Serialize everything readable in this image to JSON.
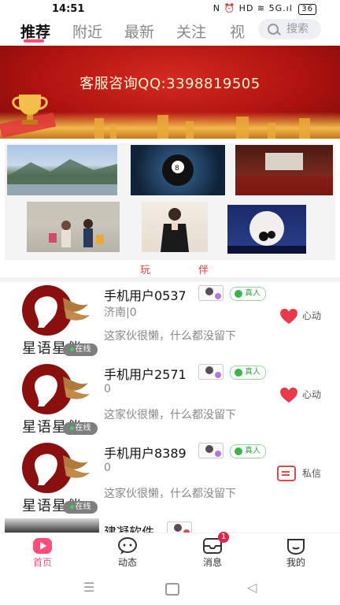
{
  "status": {
    "time": "14:51",
    "icons": "N ⏰ HD ≋ 5G.ıl",
    "battery": "36"
  },
  "tabs": [
    {
      "label": "推荐",
      "active": true
    },
    {
      "label": "附近",
      "active": false
    },
    {
      "label": "最新",
      "active": false
    },
    {
      "label": "关注",
      "active": false
    },
    {
      "label": "视",
      "active": false
    }
  ],
  "search": {
    "label": "搜索"
  },
  "banner": {
    "text": "客服咨询QQ:3398819505"
  },
  "grid_label": {
    "left": "玩",
    "right": "伴"
  },
  "users": [
    {
      "brand": "星语星伴",
      "online": "在线",
      "name": "手机用户0537",
      "real": "真人",
      "location": "济南|0",
      "bio": "这家伙很懒，什么都没留下",
      "action": "心动",
      "action_type": "heart"
    },
    {
      "brand": "星语星伴",
      "online": "在线",
      "name": "手机用户2571",
      "real": "真人",
      "location": "0",
      "bio": "这家伙很懒，什么都没留下",
      "action": "心动",
      "action_type": "heart"
    },
    {
      "brand": "星语星伴",
      "online": "在线",
      "name": "手机用户8389",
      "real": "真人",
      "location": "0",
      "bio": "这家伙很懒，什么都没留下",
      "action": "私信",
      "action_type": "message"
    },
    {
      "name": "建凝软件"
    }
  ],
  "bottom_nav": [
    {
      "label": "首页",
      "active": true
    },
    {
      "label": "动态",
      "active": false
    },
    {
      "label": "消息",
      "active": false,
      "badge": "1"
    },
    {
      "label": "我的",
      "active": false
    }
  ],
  "colors": {
    "accent": "#ff4d7a",
    "banner_red": "#b0130f",
    "heart": "#e83a4a",
    "real_green": "#39b54a"
  }
}
